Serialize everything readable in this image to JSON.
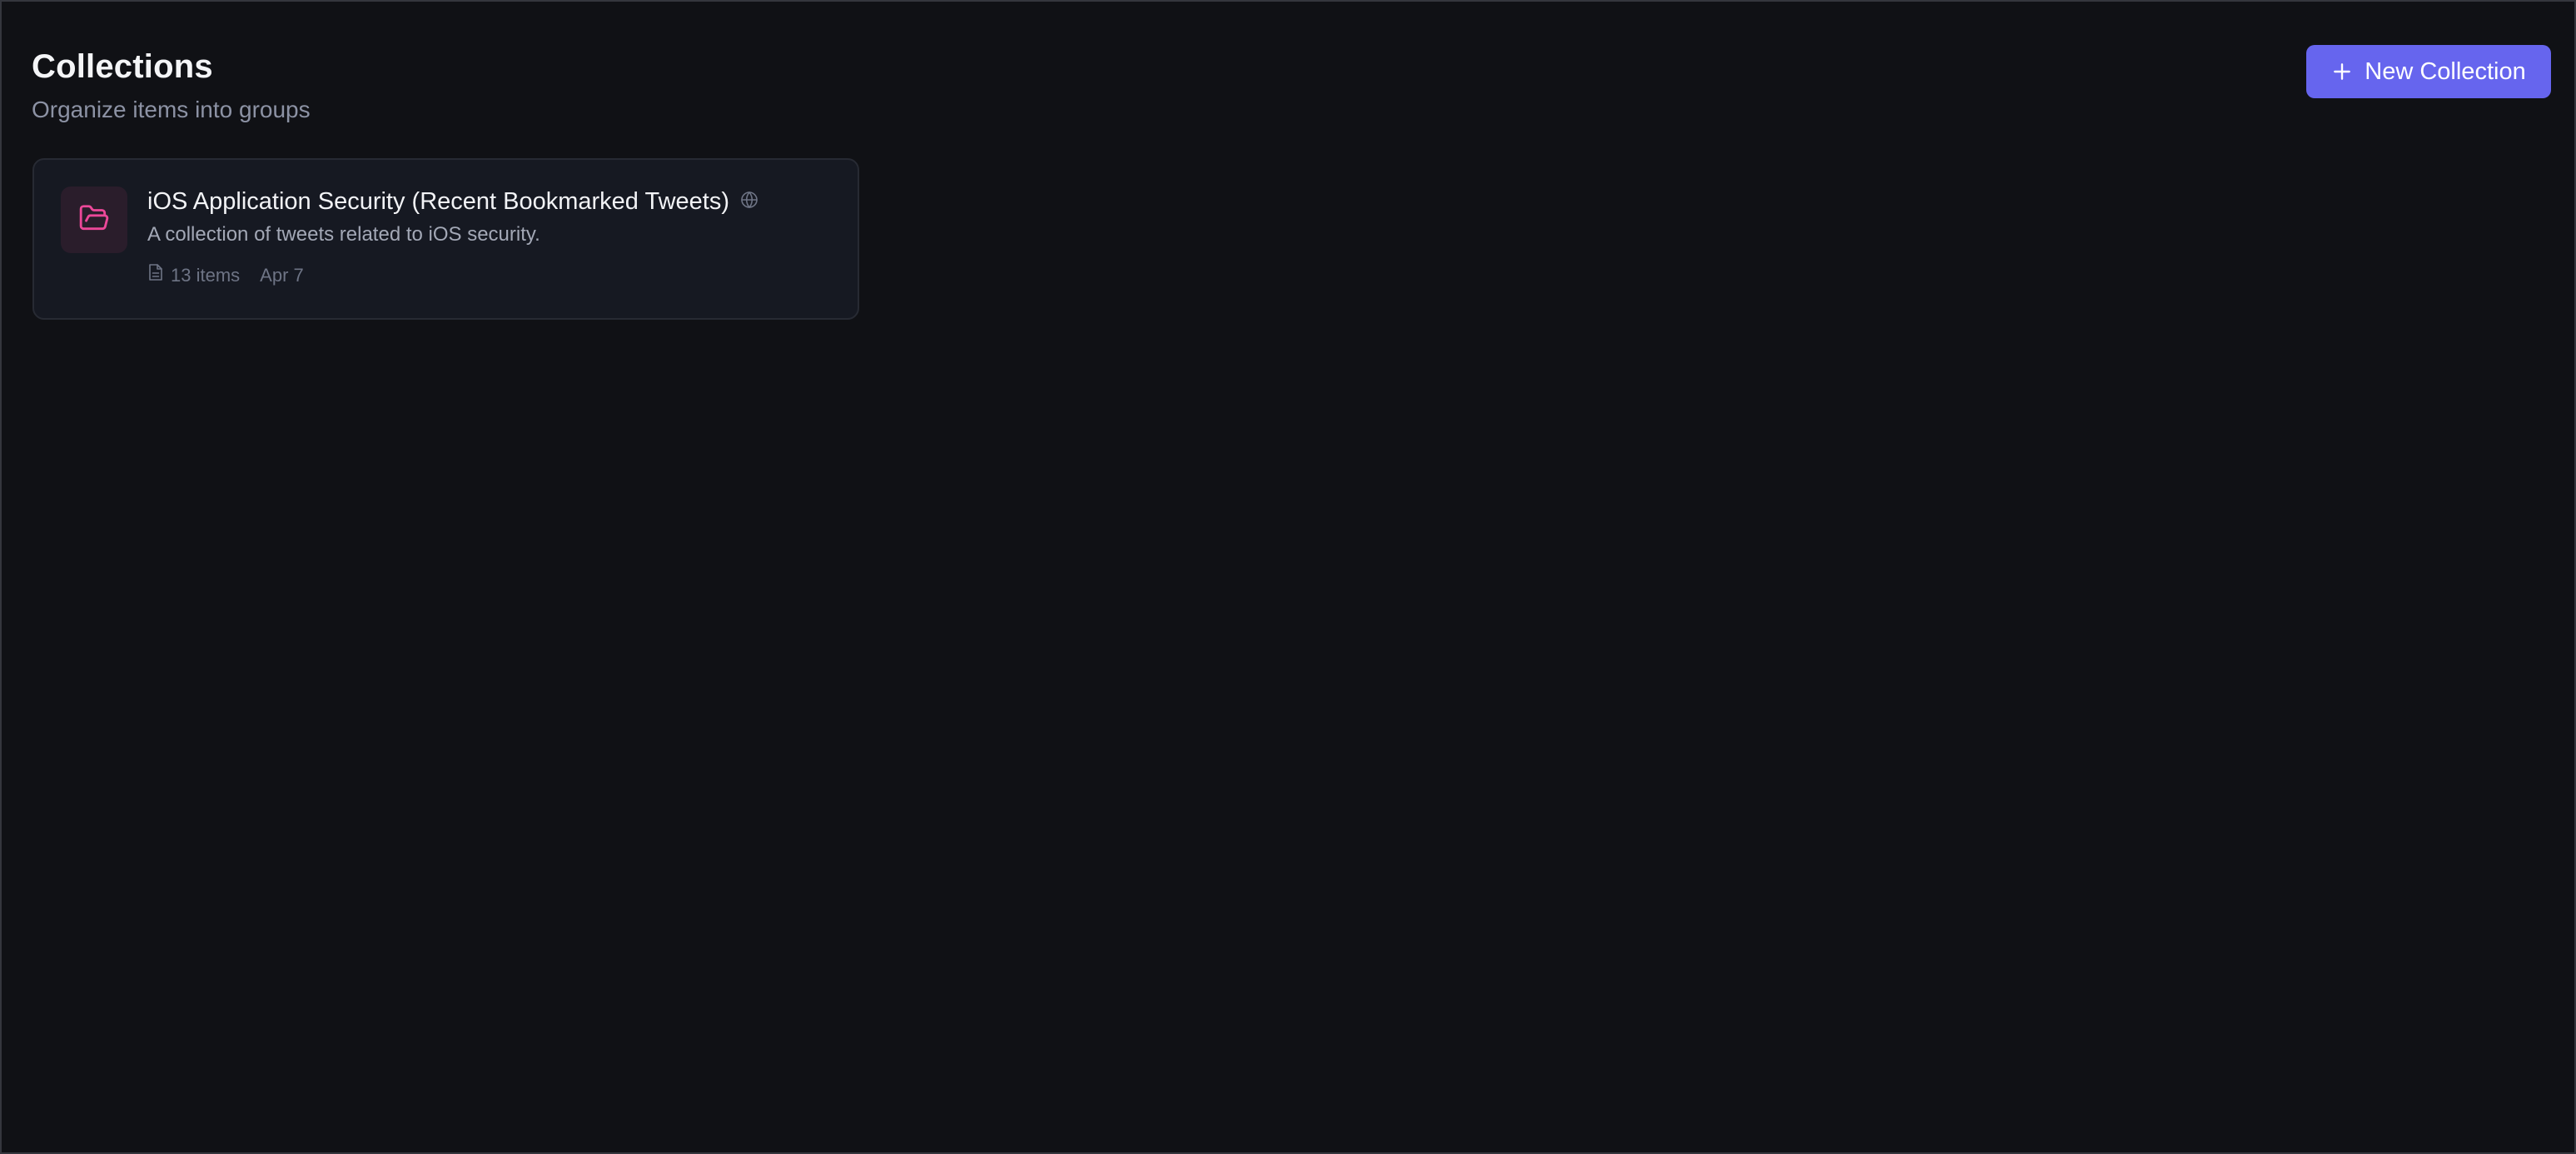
{
  "header": {
    "title": "Collections",
    "subtitle": "Organize items into groups"
  },
  "actions": {
    "new_collection_label": "New Collection",
    "new_collection_icon": "plus-icon"
  },
  "collections": [
    {
      "title": "iOS Application Security (Recent Bookmarked Tweets)",
      "description": "A collection of tweets related to iOS security.",
      "item_count": "13 items",
      "date": "Apr 7",
      "icon": "folder-open-icon",
      "visibility_icon": "globe-icon",
      "icon_color": "#ec4899"
    }
  ],
  "colors": {
    "background": "#101115",
    "accent": "#6665ee",
    "card_background": "#161922",
    "folder_icon": "#ec4899"
  }
}
